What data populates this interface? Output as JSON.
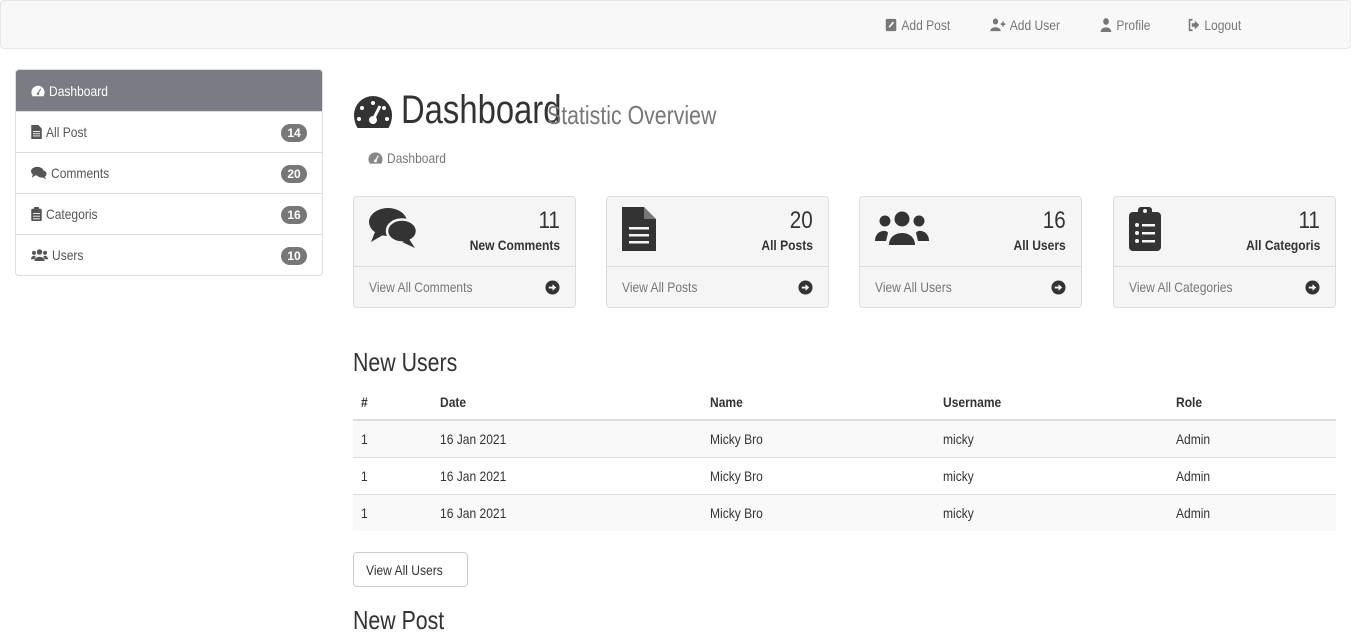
{
  "navbar": {
    "links": [
      {
        "label": "Add Post",
        "icon": "edit-icon"
      },
      {
        "label": "Add User",
        "icon": "user-plus-icon"
      },
      {
        "label": "Profile",
        "icon": "user-icon"
      },
      {
        "label": "Logout",
        "icon": "sign-out-icon"
      }
    ]
  },
  "sidebar": {
    "items": [
      {
        "label": "Dashboard",
        "icon": "dashboard-icon",
        "active": true
      },
      {
        "label": "All Post",
        "icon": "file-icon",
        "count": "14"
      },
      {
        "label": "Comments",
        "icon": "comments-icon",
        "count": "20"
      },
      {
        "label": "Categoris",
        "icon": "clipboard-icon",
        "count": "16"
      },
      {
        "label": "Users",
        "icon": "users-icon",
        "count": "10"
      }
    ]
  },
  "header": {
    "title": "Dashboard",
    "subtitle": "Statistic Overview",
    "breadcrumb": "Dashboard"
  },
  "panels": [
    {
      "value": "11",
      "label": "New Comments",
      "link": "View All Comments",
      "icon": "comments-icon"
    },
    {
      "value": "20",
      "label": "All Posts",
      "link": "View All Posts",
      "icon": "file-icon"
    },
    {
      "value": "16",
      "label": "All Users",
      "link": "View All Users",
      "icon": "users-icon"
    },
    {
      "value": "11",
      "label": "All Categoris",
      "link": "View All Categories",
      "icon": "clipboard-list-icon"
    }
  ],
  "new_users": {
    "title": "New Users",
    "columns": [
      "#",
      "Date",
      "Name",
      "Username",
      "Role"
    ],
    "rows": [
      [
        "1",
        "16 Jan 2021",
        "Micky Bro",
        "micky",
        "Admin"
      ],
      [
        "1",
        "16 Jan 2021",
        "Micky Bro",
        "micky",
        "Admin"
      ],
      [
        "1",
        "16 Jan 2021",
        "Micky Bro",
        "micky",
        "Admin"
      ]
    ],
    "button": "View All Users"
  },
  "new_post": {
    "title": "New Post"
  },
  "colors": {
    "sidebar_active": "#7b7b83",
    "badge": "#777777",
    "panel_bg": "#f5f5f5",
    "navbar_bg": "#f8f8f8"
  }
}
